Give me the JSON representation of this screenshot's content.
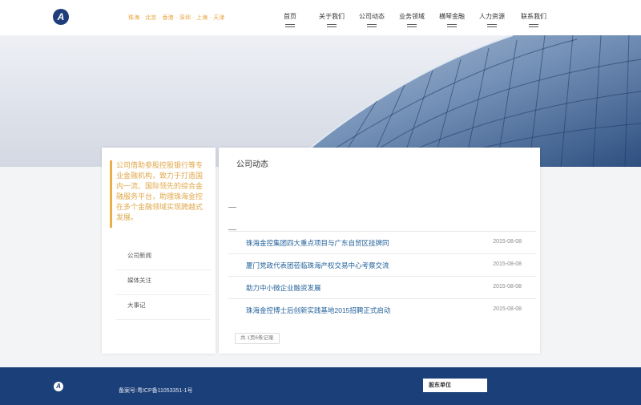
{
  "header": {
    "logo_letter": "A",
    "cities": "珠海 · 北京 · 香港 · 深圳 · 上海 · 天津",
    "nav": [
      {
        "label": "首页"
      },
      {
        "label": "关于我们"
      },
      {
        "label": "公司动态"
      },
      {
        "label": "业务领域"
      },
      {
        "label": "横琴金融"
      },
      {
        "label": "人力资源"
      },
      {
        "label": "联系我们"
      }
    ]
  },
  "sidebar": {
    "intro": "公司借助参股控股银行等专业金融机构，致力于打造国内一流、国际领先的综合金融服务平台，助理珠海金控在多个金融领域实现跨越式发展。",
    "menu": [
      {
        "label": "公司新闻"
      },
      {
        "label": "媒体关注"
      },
      {
        "label": "大事记"
      }
    ]
  },
  "main": {
    "title": "公司动态",
    "news": [
      {
        "title": "珠海金控集团四大重点项目与广东自贸区挂牌同",
        "date": "2015-08-08"
      },
      {
        "title": "厦门党政代表团莅临珠海产权交易中心考察交流",
        "date": "2015-08-08"
      },
      {
        "title": "助力中小微企业融资发展",
        "date": "2015-08-08"
      },
      {
        "title": "珠海金控博士后创新实践基地2015招聘正式启动",
        "date": "2015-08-08"
      }
    ],
    "pager": "共 1页6条记录"
  },
  "footer": {
    "logo_letter": "A",
    "icp": "备案号:粤ICP备11053351-1号",
    "select_label": "股东单位"
  },
  "colors": {
    "brand_blue": "#1b3f78",
    "accent_orange": "#e8a33c",
    "link_blue": "#1f5f99"
  }
}
